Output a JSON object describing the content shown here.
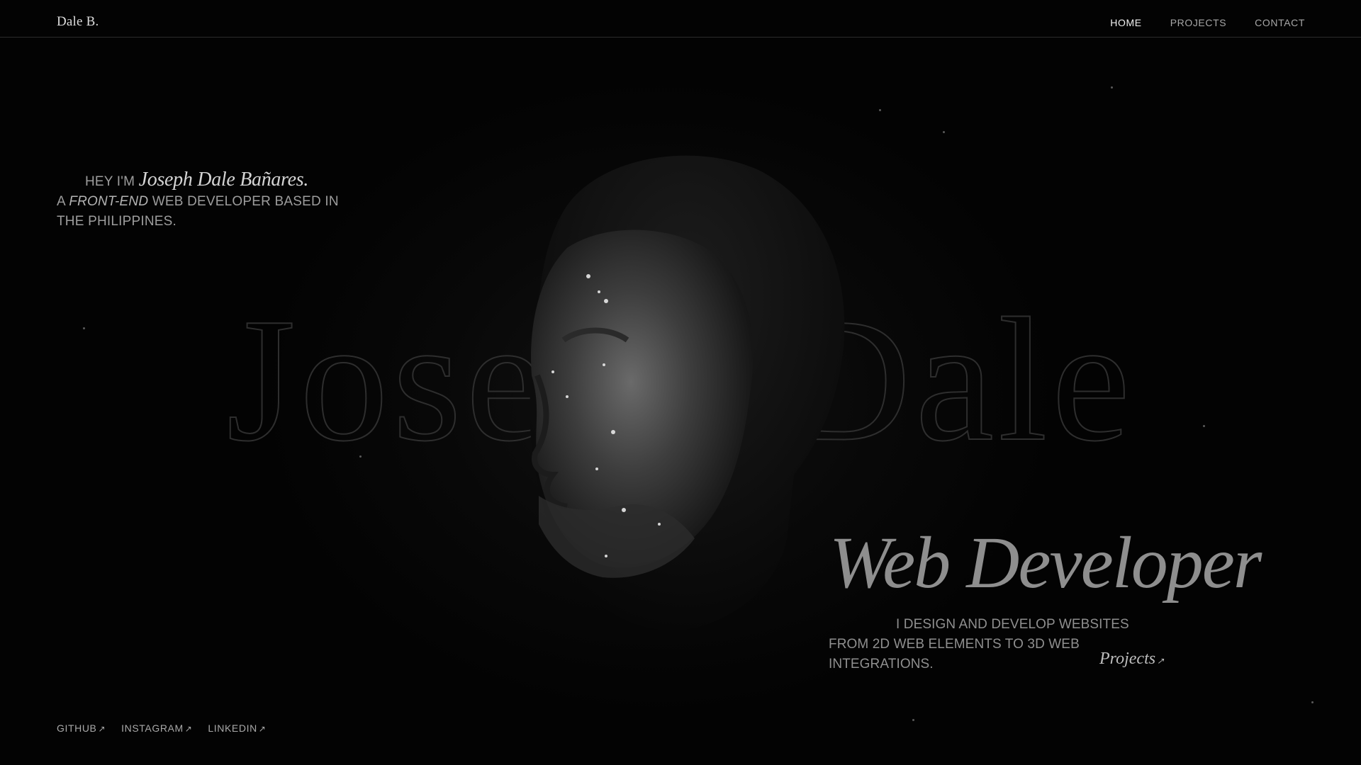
{
  "header": {
    "brand": "Dale B.",
    "nav": [
      {
        "label": "HOME",
        "active": true
      },
      {
        "label": "PROJECTS",
        "active": false
      },
      {
        "label": "CONTACT",
        "active": false
      }
    ]
  },
  "hero": {
    "greeting": "HEY I'M",
    "name": "Joseph Dale Bañares.",
    "line2_prefix": "A",
    "line2_emph": "FRONT-END",
    "line2_suffix": "WEB DEVELOPER BASED IN",
    "line3": "THE PHILIPPINES.",
    "background_name": "Joseph Dale",
    "role": "Web Developer",
    "description_line1": "I DESIGN AND DEVELOP WEBSITES",
    "description_line2": "FROM 2D WEB ELEMENTS TO 3D WEB",
    "description_line3": "INTEGRATIONS.",
    "projects_link": "Projects",
    "arrow_icon": "↗"
  },
  "socials": [
    {
      "label": "GITHUB"
    },
    {
      "label": "INSTAGRAM"
    },
    {
      "label": "LINKEDIN"
    }
  ],
  "colors": {
    "background": "#030303",
    "text": "#b9b9b9",
    "nav_active": "#f0f0f0"
  }
}
